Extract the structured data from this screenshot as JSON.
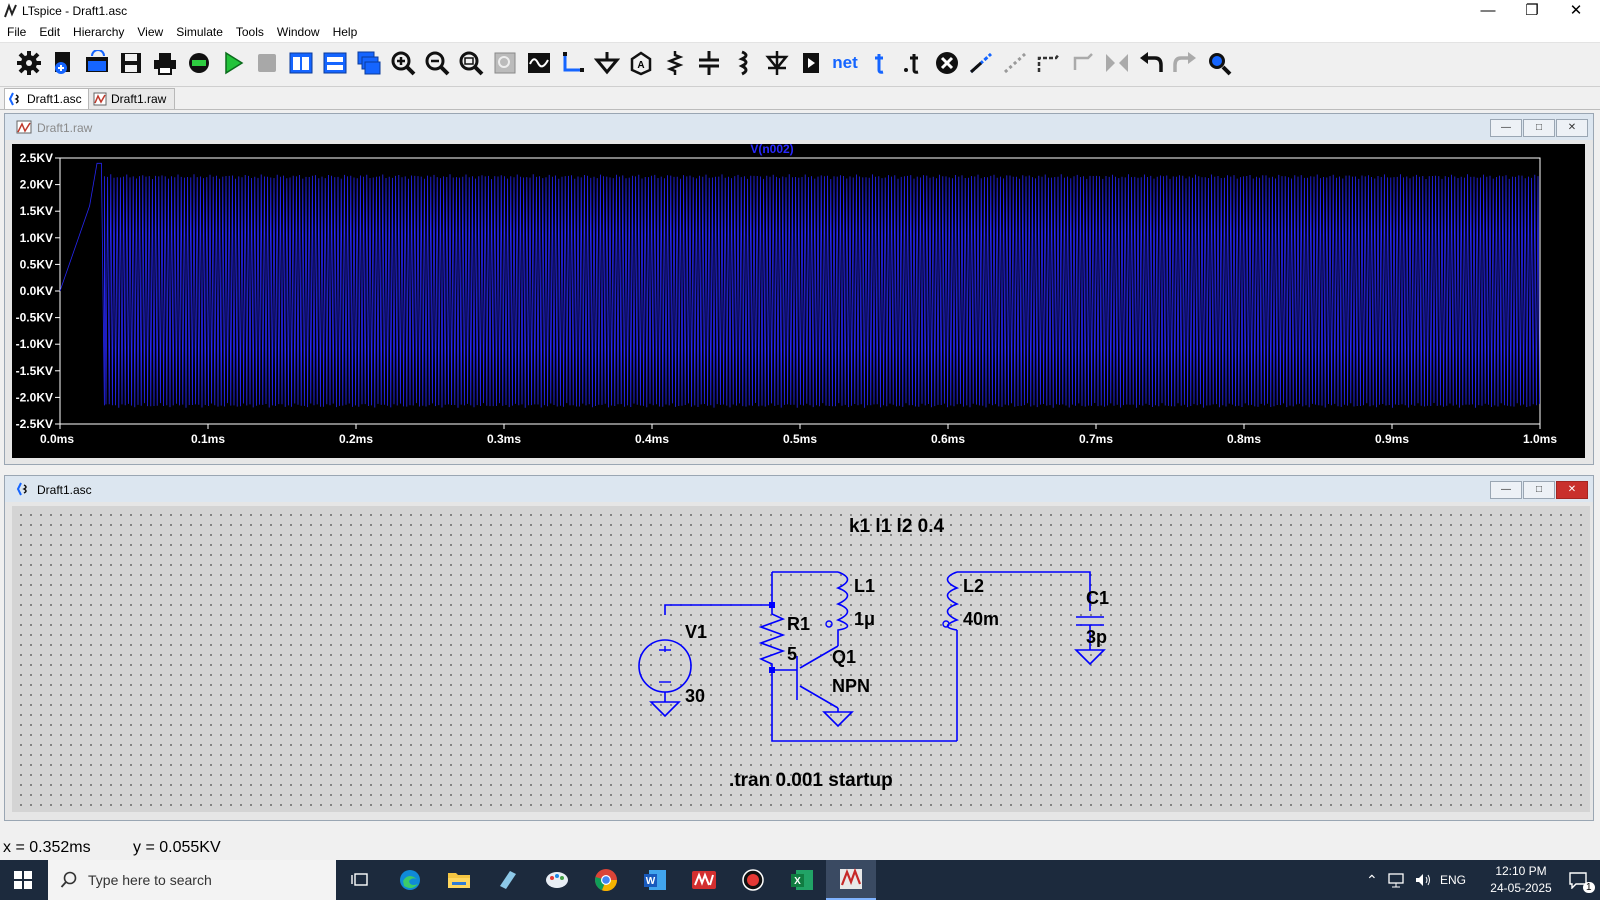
{
  "app": {
    "title": "LTspice - Draft1.asc"
  },
  "menu": [
    "File",
    "Edit",
    "Hierarchy",
    "View",
    "Simulate",
    "Tools",
    "Window",
    "Help"
  ],
  "toolbar": {
    "net_label": "net",
    "icons": [
      "settings-icon",
      "new-schematic-icon",
      "open-icon",
      "save-icon",
      "print-icon",
      "control-panel-icon",
      "run-icon",
      "halt-icon",
      "tile-vertical-icon",
      "tile-horizontal-icon",
      "cascade-icon",
      "zoom-in-icon",
      "zoom-out-icon",
      "zoom-fit-icon",
      "zoom-back-icon",
      "autorange-icon",
      "wire-icon",
      "ground-icon",
      "label-net-icon",
      "resistor-icon",
      "capacitor-icon",
      "inductor-icon",
      "diode-icon",
      "component-icon",
      "net-icon",
      "text-icon",
      "spice-directive-icon",
      "delete-icon",
      "duplicate-icon",
      "move-icon",
      "drag-icon",
      "rotate-icon",
      "mirror-icon",
      "undo-icon",
      "redo-icon",
      "find-icon"
    ]
  },
  "tabs": [
    {
      "label": "Draft1.asc",
      "active": true
    },
    {
      "label": "Draft1.raw",
      "active": false
    }
  ],
  "waveform_window": {
    "title": "Draft1.raw",
    "trace_label": "V(n002)",
    "trace_color": "#2828ff",
    "chart_data": {
      "type": "line",
      "title": "",
      "series": [
        {
          "name": "V(n002)",
          "color": "#2828ff",
          "description_points": [
            [
              0.0,
              0.0
            ],
            [
              0.02,
              1.6
            ],
            [
              0.025,
              2.4
            ],
            [
              0.028,
              2.4
            ],
            [
              0.03,
              -2.15
            ]
          ],
          "steady_state": {
            "x_start": 0.03,
            "x_end": 1.0,
            "y_max": 2.15,
            "y_min": -2.15,
            "oscillating": true
          }
        }
      ],
      "xlim": [
        0.0,
        1.0
      ],
      "ylim": [
        -2.5,
        2.5
      ],
      "x_ticks": [
        "0.0ms",
        "0.1ms",
        "0.2ms",
        "0.3ms",
        "0.4ms",
        "0.5ms",
        "0.6ms",
        "0.7ms",
        "0.8ms",
        "0.9ms",
        "1.0ms"
      ],
      "y_ticks": [
        "2.5KV",
        "2.0KV",
        "1.5KV",
        "1.0KV",
        "0.5KV",
        "0.0KV",
        "-0.5KV",
        "-1.0KV",
        "-1.5KV",
        "-2.0KV",
        "-2.5KV"
      ],
      "grid": false,
      "background": "#000000"
    }
  },
  "schematic_window": {
    "title": "Draft1.asc",
    "directive_coupling": "k1 l1 l2 0.4",
    "directive_tran": ".tran 0.001 startup",
    "components": {
      "V1": {
        "name": "V1",
        "value": "30"
      },
      "R1": {
        "name": "R1",
        "value": "5"
      },
      "L1": {
        "name": "L1",
        "value": "1μ"
      },
      "L2": {
        "name": "L2",
        "value": "40m"
      },
      "Q1": {
        "name": "Q1",
        "value": "NPN"
      },
      "C1": {
        "name": "C1",
        "value": "3p"
      }
    },
    "wire_color": "#0000ff"
  },
  "status": {
    "x": "x = 0.352ms",
    "y": "y = 0.055KV"
  },
  "taskbar": {
    "search_placeholder": "Type here to search",
    "language": "ENG",
    "time": "12:10 PM",
    "date": "24-05-2025",
    "notification_count": "1"
  }
}
